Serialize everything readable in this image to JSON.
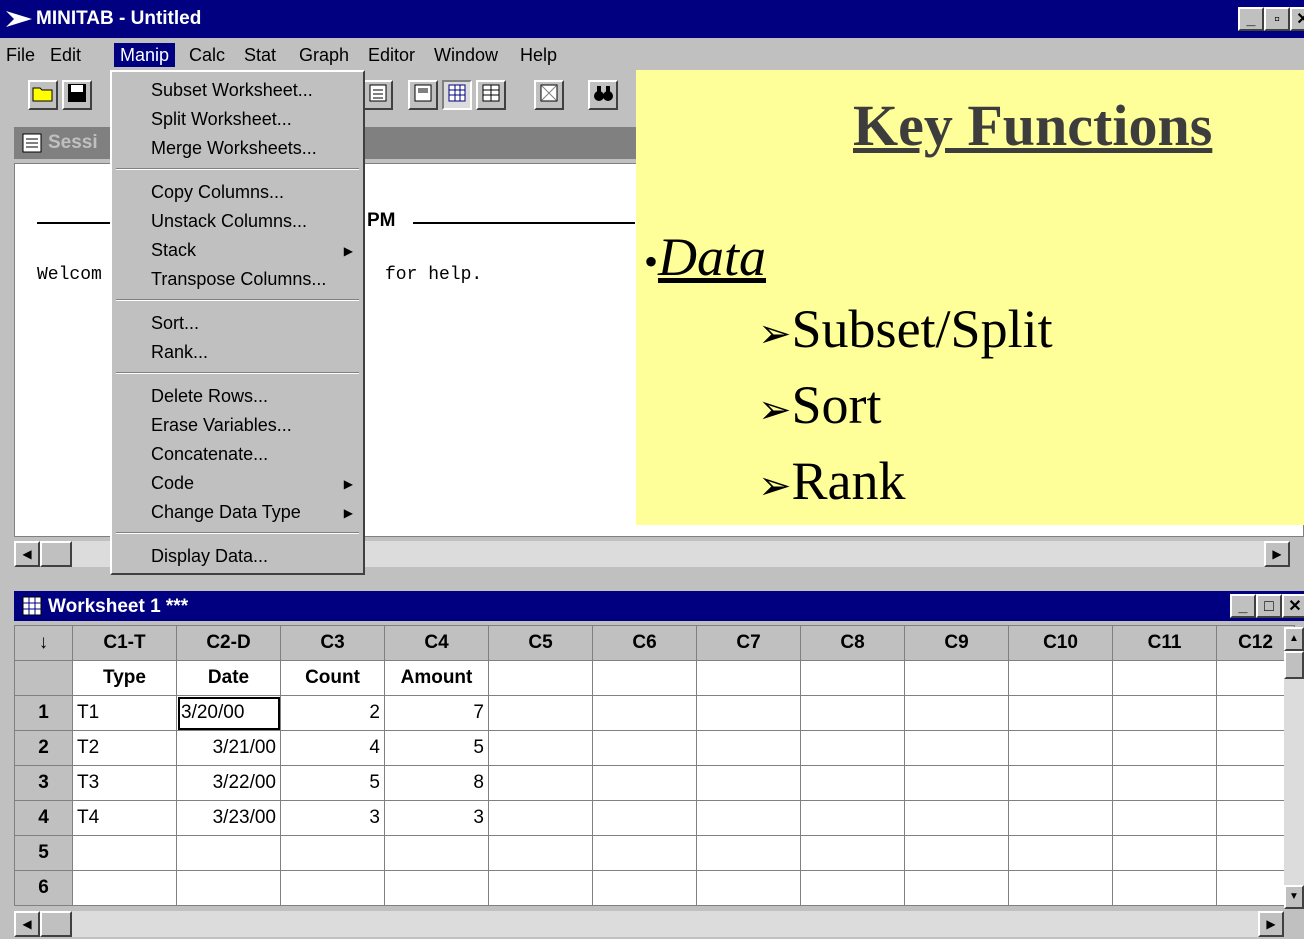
{
  "app": {
    "title": "MINITAB - Untitled"
  },
  "menubar": [
    "File",
    "Edit",
    "Manip",
    "Calc",
    "Stat",
    "Graph",
    "Editor",
    "Window",
    "Help"
  ],
  "manip_menu": {
    "items": [
      {
        "label": "Subset Worksheet...",
        "submenu": false
      },
      {
        "label": "Split Worksheet...",
        "submenu": false
      },
      {
        "label": "Merge Worksheets...",
        "submenu": false
      },
      {
        "label": "Copy Columns...",
        "submenu": false
      },
      {
        "label": "Unstack Columns...",
        "submenu": false
      },
      {
        "label": "Stack",
        "submenu": true
      },
      {
        "label": "Transpose Columns...",
        "submenu": false
      },
      {
        "label": "Sort...",
        "submenu": false
      },
      {
        "label": "Rank...",
        "submenu": false
      },
      {
        "label": "Delete Rows...",
        "submenu": false
      },
      {
        "label": "Erase Variables...",
        "submenu": false
      },
      {
        "label": "Concatenate...",
        "submenu": false
      },
      {
        "label": "Code",
        "submenu": true
      },
      {
        "label": "Change Data Type",
        "submenu": true
      },
      {
        "label": "Display Data...",
        "submenu": false
      }
    ]
  },
  "session": {
    "title": "Sessi",
    "time_fragment": "PM",
    "welcome_left": "Welcom",
    "welcome_right": "for help."
  },
  "key_box": {
    "title": "Key Functions",
    "bullet_char": "•",
    "heading": "Data",
    "arrow_char": "➢",
    "items": [
      "Subset/Split",
      "Sort",
      "Rank"
    ]
  },
  "worksheet": {
    "title": "Worksheet 1 ***",
    "corner": "↓",
    "columns": [
      "C1-T",
      "C2-D",
      "C3",
      "C4",
      "C5",
      "C6",
      "C7",
      "C8",
      "C9",
      "C10",
      "C11",
      "C12"
    ],
    "names": [
      "Type",
      "Date",
      "Count",
      "Amount",
      "",
      "",
      "",
      "",
      "",
      "",
      "",
      ""
    ],
    "rows": [
      {
        "n": "1",
        "cells": [
          "T1",
          "3/20/00",
          "2",
          "7"
        ]
      },
      {
        "n": "2",
        "cells": [
          "T2",
          "3/21/00",
          "4",
          "5"
        ]
      },
      {
        "n": "3",
        "cells": [
          "T3",
          "3/22/00",
          "5",
          "8"
        ]
      },
      {
        "n": "4",
        "cells": [
          "T4",
          "3/23/00",
          "3",
          "3"
        ]
      },
      {
        "n": "5",
        "cells": [
          "",
          "",
          "",
          ""
        ]
      },
      {
        "n": "6",
        "cells": [
          "",
          "",
          "",
          ""
        ]
      }
    ]
  }
}
